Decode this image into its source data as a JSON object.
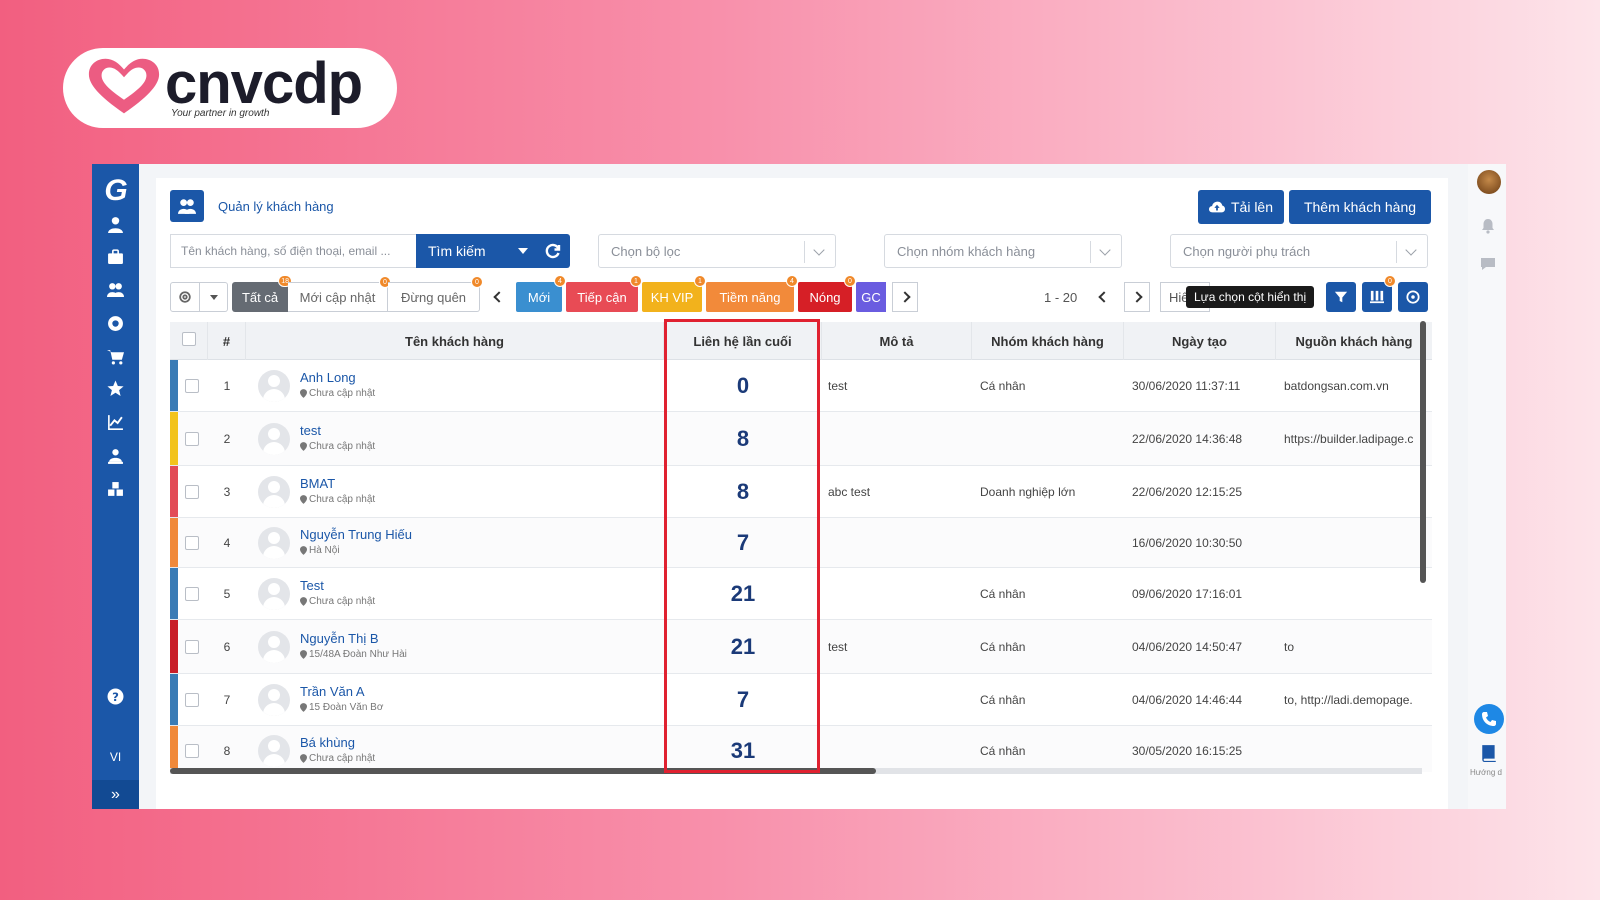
{
  "brand": {
    "name": "cnvcdp",
    "tagline": "Your partner in growth",
    "heart_color": "#ec5c82"
  },
  "app": {
    "accent": "#1b57a8",
    "page_title": "Quản lý khách hàng",
    "upload_label": "Tải lên",
    "add_customer_label": "Thêm khách hàng",
    "sidebar_lang": "VI"
  },
  "search": {
    "placeholder": "Tên khách hàng, số điện thoại, email ...",
    "button_label": "Tìm kiếm"
  },
  "selects": {
    "filter_placeholder": "Chọn bộ lọc",
    "group_placeholder": "Chọn nhóm khách hàng",
    "owner_placeholder": "Chọn người phụ trách"
  },
  "filters": {
    "all": {
      "label": "Tất cả",
      "badge": "18"
    },
    "recent": {
      "label": "Mới cập nhật",
      "badge": "0"
    },
    "forget": {
      "label": "Đừng quên",
      "badge": "0"
    },
    "tags": [
      {
        "label": "Mới",
        "badge": "4",
        "color": "#3a8fd0"
      },
      {
        "label": "Tiếp cận",
        "badge": "1",
        "color": "#e84b55"
      },
      {
        "label": "KH VIP",
        "badge": "1",
        "color": "#f2b21c"
      },
      {
        "label": "Tiềm năng",
        "badge": "4",
        "color": "#f28a3a"
      },
      {
        "label": "Nóng",
        "badge": "0",
        "color": "#d61f26"
      },
      {
        "label": "GC",
        "badge": "",
        "color": "#6a5ce0"
      }
    ]
  },
  "pager": {
    "range": "1 - 20",
    "show_label": "Hiể",
    "tooltip": "Lựa chọn cột hiển thị",
    "settings_badge": "0"
  },
  "table": {
    "headers": {
      "num": "#",
      "name": "Tên khách hàng",
      "last_contact": "Liên hệ lần cuối",
      "desc": "Mô tả",
      "group": "Nhóm khách hàng",
      "created": "Ngày tạo",
      "source": "Nguồn khách hàng"
    },
    "rows": [
      {
        "num": "1",
        "name": "Anh Long",
        "location": "Chưa cập nhật",
        "last_contact": "0",
        "desc": "test",
        "group": "Cá nhân",
        "created": "30/06/2020 11:37:11",
        "source": "batdongsan.com.vn",
        "stripe": "#3a7bb5"
      },
      {
        "num": "2",
        "name": "test",
        "location": "Chưa cập nhật",
        "last_contact": "8",
        "desc": "",
        "group": "",
        "created": "22/06/2020 14:36:48",
        "source": "https://builder.ladipage.c",
        "stripe": "#f2c31c"
      },
      {
        "num": "3",
        "name": "BMAT",
        "location": "Chưa cập nhật",
        "last_contact": "8",
        "desc": "abc test",
        "group": "Doanh nghiệp lớn",
        "created": "22/06/2020 12:15:25",
        "source": "",
        "stripe": "#e24b56"
      },
      {
        "num": "4",
        "name": "Nguyễn Trung Hiếu",
        "location": "Hà Nội",
        "last_contact": "7",
        "desc": "",
        "group": "",
        "created": "16/06/2020 10:30:50",
        "source": "",
        "stripe": "#f0893a"
      },
      {
        "num": "5",
        "name": "Test",
        "location": "Chưa cập nhật",
        "last_contact": "21",
        "desc": "",
        "group": "Cá nhân",
        "created": "09/06/2020 17:16:01",
        "source": "",
        "stripe": "#3a7bb5"
      },
      {
        "num": "6",
        "name": "Nguyễn Thị B",
        "location": "15/48A Đoàn Như Hài",
        "last_contact": "21",
        "desc": "test",
        "group": "Cá nhân",
        "created": "04/06/2020 14:50:47",
        "source": "to",
        "stripe": "#c81e28"
      },
      {
        "num": "7",
        "name": "Trần Văn A",
        "location": "15 Đoàn Văn Bơ",
        "last_contact": "7",
        "desc": "",
        "group": "Cá nhân",
        "created": "04/06/2020 14:46:44",
        "source": "to, http://ladi.demopage.",
        "stripe": "#3a7bb5"
      },
      {
        "num": "8",
        "name": "Bá khùng",
        "location": "Chưa cập nhật",
        "last_contact": "31",
        "desc": "",
        "group": "Cá nhân",
        "created": "30/05/2020 16:15:25",
        "source": "",
        "stripe": "#f0893a"
      }
    ]
  },
  "right_rail": {
    "guide_label": "Hướng d"
  }
}
